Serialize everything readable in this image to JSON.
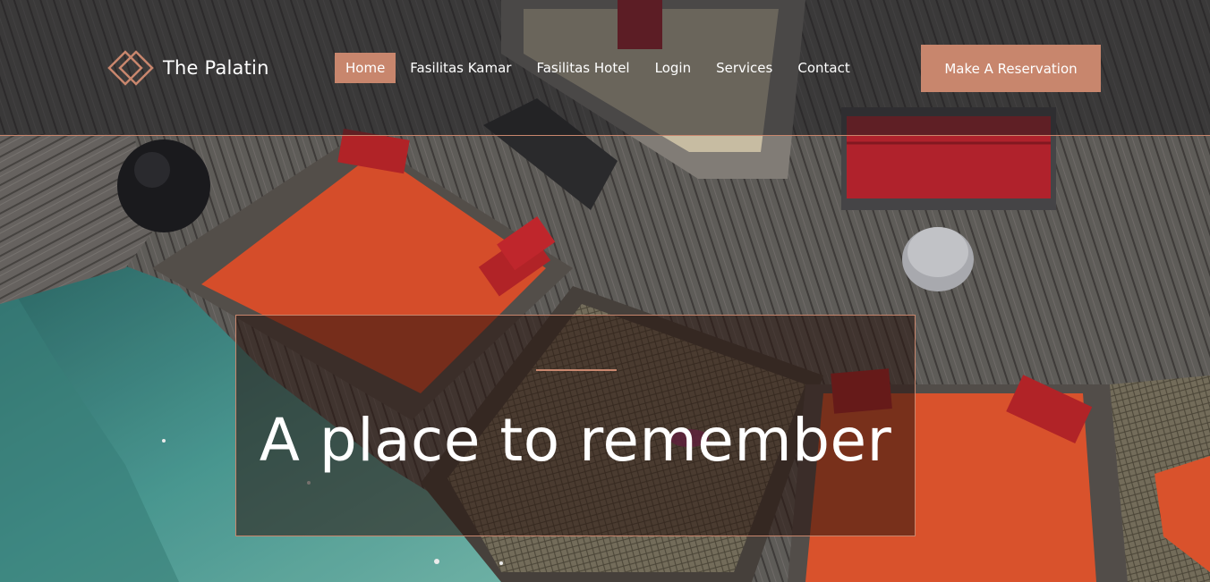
{
  "brand": {
    "name": "The Palatin",
    "logo_icon": "diamond-logo-icon"
  },
  "nav": {
    "items": [
      {
        "label": "Home",
        "active": true
      },
      {
        "label": "Fasilitas Kamar",
        "active": false
      },
      {
        "label": "Fasilitas Hotel",
        "active": false
      },
      {
        "label": "Login",
        "active": false
      },
      {
        "label": "Services",
        "active": false
      },
      {
        "label": "Contact",
        "active": false
      }
    ]
  },
  "cta": {
    "label": "Make A Reservation"
  },
  "hero": {
    "title": "A place to remember"
  },
  "colors": {
    "accent": "#c8866d",
    "text": "#ffffff",
    "header_overlay": "#1e1e20"
  }
}
